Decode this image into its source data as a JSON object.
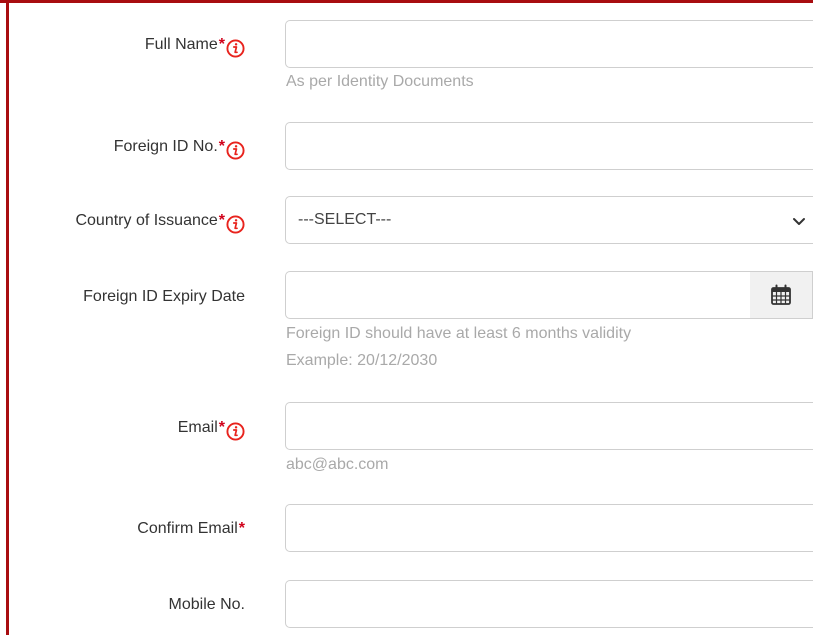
{
  "form": {
    "full_name": {
      "label": "Full Name",
      "required": "*",
      "value": "",
      "help": "As per Identity Documents"
    },
    "foreign_id": {
      "label": "Foreign ID No.",
      "required": "*",
      "value": ""
    },
    "country": {
      "label": "Country of Issuance",
      "required": "*",
      "selected": "---SELECT---"
    },
    "expiry": {
      "label": "Foreign ID Expiry Date",
      "value": "",
      "help_line1": "Foreign ID should have at least 6 months validity",
      "help_line2": "Example: 20/12/2030"
    },
    "email": {
      "label": "Email",
      "required": "*",
      "value": "",
      "help": "abc@abc.com"
    },
    "confirm_email": {
      "label": "Confirm Email",
      "required": "*",
      "value": ""
    },
    "mobile": {
      "label": "Mobile No.",
      "value": ""
    }
  },
  "icons": {
    "info": "info-icon",
    "calendar": "calendar-icon",
    "dropdown": "chevron-down-icon"
  },
  "colors": {
    "accent_border": "#a80d10",
    "required": "#d0021b",
    "help_text": "#a9a9a9"
  }
}
